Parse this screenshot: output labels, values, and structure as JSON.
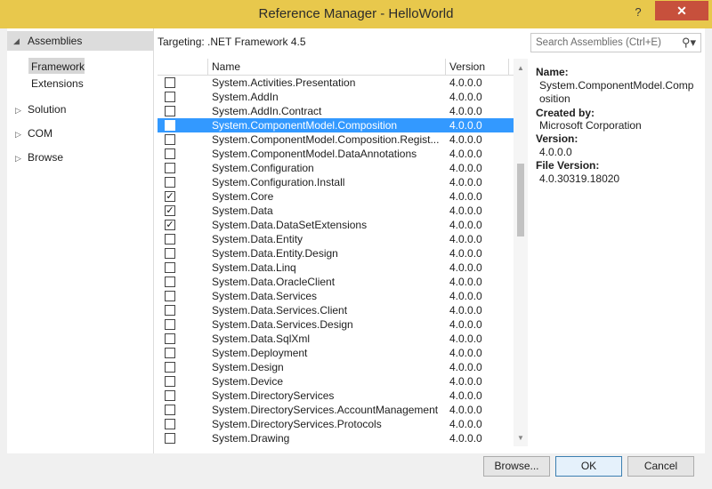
{
  "window": {
    "title": "Reference Manager - HelloWorld",
    "help": "?",
    "close": "✕"
  },
  "nav": {
    "assemblies": "Assemblies",
    "framework": "Framework",
    "extensions": "Extensions",
    "solution": "Solution",
    "com": "COM",
    "browse": "Browse"
  },
  "targeting": "Targeting: .NET Framework 4.5",
  "search": {
    "placeholder": "Search Assemblies (Ctrl+E)",
    "icon": "search-icon"
  },
  "grid": {
    "columns": [
      "Name",
      "Version"
    ],
    "rows": [
      {
        "name": "System.Activities.Presentation",
        "version": "4.0.0.0",
        "checked": false,
        "selected": false
      },
      {
        "name": "System.AddIn",
        "version": "4.0.0.0",
        "checked": false,
        "selected": false
      },
      {
        "name": "System.AddIn.Contract",
        "version": "4.0.0.0",
        "checked": false,
        "selected": false
      },
      {
        "name": "System.ComponentModel.Composition",
        "version": "4.0.0.0",
        "checked": false,
        "selected": true
      },
      {
        "name": "System.ComponentModel.Composition.Regist...",
        "version": "4.0.0.0",
        "checked": false,
        "selected": false
      },
      {
        "name": "System.ComponentModel.DataAnnotations",
        "version": "4.0.0.0",
        "checked": false,
        "selected": false
      },
      {
        "name": "System.Configuration",
        "version": "4.0.0.0",
        "checked": false,
        "selected": false
      },
      {
        "name": "System.Configuration.Install",
        "version": "4.0.0.0",
        "checked": false,
        "selected": false
      },
      {
        "name": "System.Core",
        "version": "4.0.0.0",
        "checked": true,
        "selected": false
      },
      {
        "name": "System.Data",
        "version": "4.0.0.0",
        "checked": true,
        "selected": false
      },
      {
        "name": "System.Data.DataSetExtensions",
        "version": "4.0.0.0",
        "checked": true,
        "selected": false
      },
      {
        "name": "System.Data.Entity",
        "version": "4.0.0.0",
        "checked": false,
        "selected": false
      },
      {
        "name": "System.Data.Entity.Design",
        "version": "4.0.0.0",
        "checked": false,
        "selected": false
      },
      {
        "name": "System.Data.Linq",
        "version": "4.0.0.0",
        "checked": false,
        "selected": false
      },
      {
        "name": "System.Data.OracleClient",
        "version": "4.0.0.0",
        "checked": false,
        "selected": false
      },
      {
        "name": "System.Data.Services",
        "version": "4.0.0.0",
        "checked": false,
        "selected": false
      },
      {
        "name": "System.Data.Services.Client",
        "version": "4.0.0.0",
        "checked": false,
        "selected": false
      },
      {
        "name": "System.Data.Services.Design",
        "version": "4.0.0.0",
        "checked": false,
        "selected": false
      },
      {
        "name": "System.Data.SqlXml",
        "version": "4.0.0.0",
        "checked": false,
        "selected": false
      },
      {
        "name": "System.Deployment",
        "version": "4.0.0.0",
        "checked": false,
        "selected": false
      },
      {
        "name": "System.Design",
        "version": "4.0.0.0",
        "checked": false,
        "selected": false
      },
      {
        "name": "System.Device",
        "version": "4.0.0.0",
        "checked": false,
        "selected": false
      },
      {
        "name": "System.DirectoryServices",
        "version": "4.0.0.0",
        "checked": false,
        "selected": false
      },
      {
        "name": "System.DirectoryServices.AccountManagement",
        "version": "4.0.0.0",
        "checked": false,
        "selected": false
      },
      {
        "name": "System.DirectoryServices.Protocols",
        "version": "4.0.0.0",
        "checked": false,
        "selected": false
      },
      {
        "name": "System.Drawing",
        "version": "4.0.0.0",
        "checked": false,
        "selected": false
      }
    ]
  },
  "details": {
    "name_label": "Name:",
    "name_value_1": "System.ComponentModel.Comp",
    "name_value_2": "osition",
    "created_label": "Created by:",
    "created_value": "Microsoft Corporation",
    "version_label": "Version:",
    "version_value": "4.0.0.0",
    "file_version_label": "File Version:",
    "file_version_value": "4.0.30319.18020"
  },
  "buttons": {
    "browse": "Browse...",
    "ok": "OK",
    "cancel": "Cancel"
  },
  "colors": {
    "titlebar": "#e8c84c",
    "close": "#c7503c",
    "selection": "#3399ff"
  }
}
